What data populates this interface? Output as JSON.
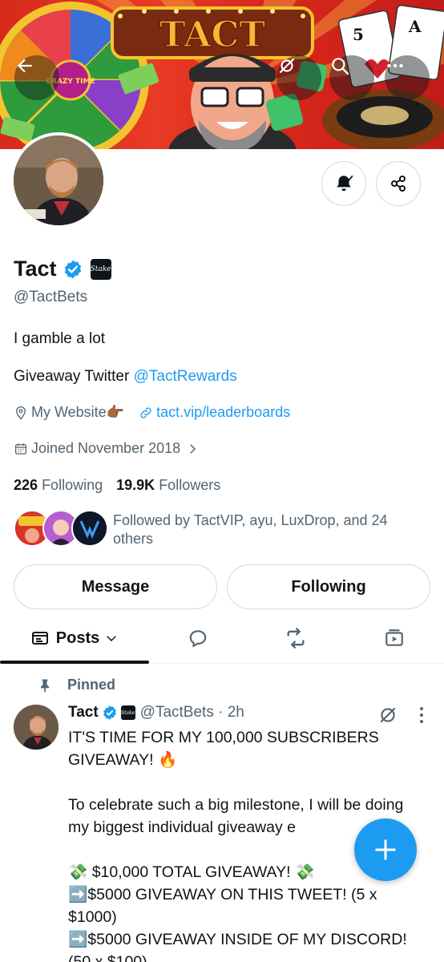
{
  "profile": {
    "name": "Tact",
    "badge_label": "Stake",
    "handle": "@TactBets",
    "bio_line1": "I gamble a lot",
    "bio_line2_prefix": "Giveaway Twitter ",
    "bio_line2_link": "@TactRewards",
    "website_label": "My Website👉🏾",
    "website_link": "tact.vip/leaderboards",
    "joined": "Joined November 2018",
    "following_count": "226",
    "following_label": "Following",
    "followers_count": "19.9K",
    "followers_label": "Followers",
    "followed_by": "Followed by TactVIP, ayu, LuxDrop, and 24 others"
  },
  "banner": {
    "sign_text": "TACT",
    "wheel_center": "CRAZY TIME",
    "card1": "5",
    "card2": "A"
  },
  "buttons": {
    "message": "Message",
    "following": "Following"
  },
  "tabs": {
    "posts": "Posts"
  },
  "post": {
    "pinned_label": "Pinned",
    "author": "Tact",
    "handle_time": "@TactBets · 2h",
    "body": "IT'S TIME FOR MY 100,000 SUBSCRIBERS GIVEAWAY! 🔥\n\nTo celebrate such a big milestone, I will be doing my biggest individual giveaway e\n\n💸 $10,000 TOTAL GIVEAWAY! 💸\n➡️$5000 GIVEAWAY ON THIS TWEET! (5 x $1000)\n➡️$5000 GIVEAWAY INSIDE OF MY DISCORD!\n(50 x $100)"
  },
  "colors": {
    "accent": "#1d9bf0",
    "text": "#0f1419",
    "secondary": "#536471",
    "border": "#cfd9de"
  },
  "icons": [
    "back-arrow-icon",
    "satellite-icon",
    "search-icon",
    "more-icon",
    "bell-icon",
    "share-icon",
    "verified-icon",
    "location-icon",
    "link-icon",
    "calendar-icon",
    "chevron-right-icon",
    "posts-icon",
    "reply-icon",
    "repost-icon",
    "media-icon",
    "pin-icon",
    "plus-icon"
  ]
}
